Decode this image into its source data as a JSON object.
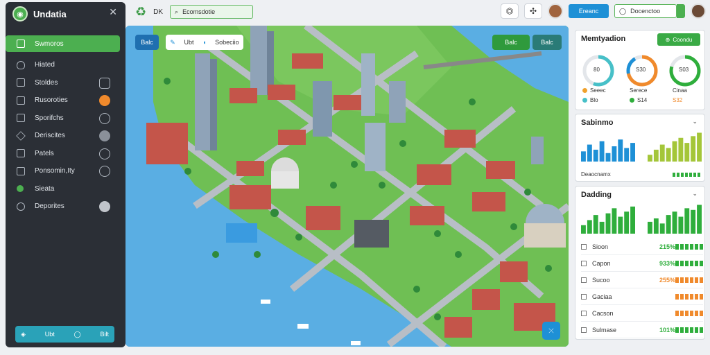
{
  "sidebar": {
    "title": "Undatia",
    "close_icon": "close-icon",
    "items": [
      {
        "label": "Swmoros",
        "icon": "file-icon",
        "active": true
      },
      {
        "label": "Hiated",
        "icon": "shield-icon"
      },
      {
        "label": "Stoldes",
        "icon": "list-icon"
      },
      {
        "label": "Rusoroties",
        "icon": "clipboard-icon"
      },
      {
        "label": "Sporifchs",
        "icon": "globe-icon"
      },
      {
        "label": "Deriscites",
        "icon": "alert-icon"
      },
      {
        "label": "Patels",
        "icon": "calendar-icon"
      },
      {
        "label": "Ponsomin,Ity",
        "icon": "chart-icon"
      },
      {
        "label": "Sieata",
        "icon": "dot-icon"
      },
      {
        "label": "Deporites",
        "icon": "target-icon"
      }
    ],
    "footer": {
      "left": "Ubt",
      "right": "Bilt"
    }
  },
  "topbar": {
    "label": "DK",
    "search_placeholder": "Ecomsdotie",
    "right_button": "Ereanc",
    "right_search": "Docenctoo"
  },
  "map": {
    "top_left_btn": "Balc",
    "layer_label": "Ubt",
    "layer_label2": "Sobeciio",
    "right_btn1": "Balc",
    "right_btn2": "Balc"
  },
  "metrics": {
    "title": "Memtyadion",
    "action": "Coondu",
    "gauges": [
      {
        "value": "80",
        "color": "#47c0c8"
      },
      {
        "value": "S30",
        "color": "#f08a2c"
      },
      {
        "value": "S03",
        "color": "#2fae3c"
      }
    ],
    "legend": [
      {
        "label": "Seeec",
        "color": "#f0a12c"
      },
      {
        "label": "Blo",
        "color": "#47c0c8"
      },
      {
        "label": "Serece",
        "color": "#1e90d6"
      },
      {
        "label": "S14",
        "color": "#2fae3c"
      },
      {
        "label": "Cinaa",
        "color": "#999999"
      },
      {
        "label": "S32",
        "color": "#f08a2c"
      }
    ]
  },
  "chart_data": [
    {
      "type": "bar",
      "title": "Sabinmo",
      "series": [
        {
          "values": [
            12,
            20,
            14,
            24,
            10,
            18,
            26,
            16,
            22
          ]
        },
        {
          "values": [
            8,
            14,
            20,
            16,
            24,
            28,
            22,
            30,
            34
          ]
        }
      ],
      "colors": [
        "#1e90d6",
        "#a4c639"
      ],
      "axis_label": "Deaocnamx"
    },
    {
      "type": "bar",
      "title": "Dadding",
      "series": [
        {
          "values": [
            10,
            16,
            22,
            14,
            24,
            30,
            20,
            26,
            32
          ]
        },
        {
          "values": [
            14,
            18,
            12,
            22,
            26,
            20,
            30,
            28,
            34
          ]
        }
      ],
      "colors": [
        "#2fae3c",
        "#2fae3c"
      ]
    }
  ],
  "table": [
    {
      "label": "Sioon",
      "pct": "215%",
      "color": "#2fae3c"
    },
    {
      "label": "Capon",
      "pct": "933%",
      "color": "#2fae3c"
    },
    {
      "label": "Sucoo",
      "pct": "255%",
      "color": "#f08a2c"
    },
    {
      "label": "Gaciaa",
      "pct": "",
      "color": "#f08a2c"
    },
    {
      "label": "Cacson",
      "pct": "",
      "color": "#f08a2c"
    },
    {
      "label": "Sulmase",
      "pct": "101%",
      "color": "#2fae3c"
    }
  ]
}
